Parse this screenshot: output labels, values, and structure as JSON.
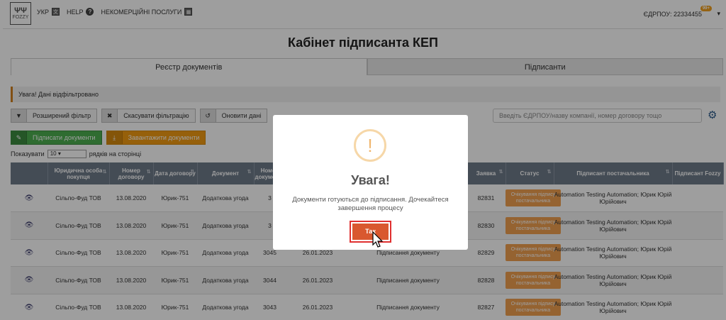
{
  "topbar": {
    "logo_mark": "ΨΨ",
    "logo_text": "FOZZY",
    "lang_label": "УКР",
    "lang_icon": "translate-icon",
    "help_label": "HELP",
    "help_icon": "question-circle-icon",
    "noncommercial_label": "НЕКОМЕРЦІЙНІ ПОСЛУГИ",
    "noncommercial_icon": "calculator-icon",
    "edrpou_label": "ЄДРПОУ: 22334455",
    "badge": "99+",
    "caret": "▾"
  },
  "page_title": "Кабінет підписанта КЕП",
  "tabs": [
    {
      "label": "Реєстр документів"
    },
    {
      "label": "Підписанти"
    }
  ],
  "alert_text": "Увага! Дані відфільтровано",
  "filter_buttons": {
    "advanced": "Розширений фільтр",
    "cancel": "Скасувати фільтрацію",
    "refresh": "Оновити дані"
  },
  "action_buttons": {
    "sign": "Підписати документи",
    "download": "Завантажити документи"
  },
  "search_placeholder": "Введіть ЄДРПОУ/назву компанії, номер договору тощо",
  "pager": {
    "show": "Показувати",
    "value": "10",
    "suffix": "рядків на сторінці"
  },
  "table": {
    "headers": [
      "",
      "Юридична особа покупця",
      "Номер договору",
      "Дата договору",
      "Документ",
      "Номер документа",
      "",
      "",
      "Заявка",
      "Статус",
      "Підписант постачальника",
      "Підписант Fozzy"
    ],
    "rows": [
      {
        "company": "Сільпо-Фуд ТОВ",
        "contract_no": "13.08.2020",
        "contract_date": "Юрик-751",
        "doc": "Додаткова угода",
        "doc_no": "3",
        "date": "",
        "type": "",
        "request": "82831",
        "status": "Очікування підпису постачальника",
        "signer": "Automation Testing Automation; Юрик Юрій Юрійович"
      },
      {
        "company": "Сільпо-Фуд ТОВ",
        "contract_no": "13.08.2020",
        "contract_date": "Юрик-751",
        "doc": "Додаткова угода",
        "doc_no": "3",
        "date": "",
        "type": "",
        "request": "82830",
        "status": "Очікування підпису постачальника",
        "signer": "Automation Testing Automation; Юрик Юрій Юрійович"
      },
      {
        "company": "Сільпо-Фуд ТОВ",
        "contract_no": "13.08.2020",
        "contract_date": "Юрик-751",
        "doc": "Додаткова угода",
        "doc_no": "3045",
        "date": "26.01.2023",
        "type": "Підписання документу",
        "request": "82829",
        "status": "Очікування підпису постачальника",
        "signer": "Automation Testing Automation; Юрик Юрій Юрійович"
      },
      {
        "company": "Сільпо-Фуд ТОВ",
        "contract_no": "13.08.2020",
        "contract_date": "Юрик-751",
        "doc": "Додаткова угода",
        "doc_no": "3044",
        "date": "26.01.2023",
        "type": "Підписання документу",
        "request": "82828",
        "status": "Очікування підпису постачальника",
        "signer": "Automation Testing Automation; Юрик Юрій Юрійович"
      },
      {
        "company": "Сільпо-Фуд ТОВ",
        "contract_no": "13.08.2020",
        "contract_date": "Юрик-751",
        "doc": "Додаткова угода",
        "doc_no": "3043",
        "date": "26.01.2023",
        "type": "Підписання документу",
        "request": "82827",
        "status": "Очікування підпису постачальника",
        "signer": "Automation Testing Automation; Юрик Юрій Юрійович"
      }
    ]
  },
  "modal": {
    "icon": "!",
    "title": "Увага!",
    "message": "Документи готуються до підписання. Дочекайтеся завершення процесу",
    "ok_label": "Так"
  },
  "colors": {
    "accent_orange": "#f39c12",
    "green": "#4caf50",
    "header_gray": "#6f7b8a",
    "confirm": "#d9582f"
  }
}
